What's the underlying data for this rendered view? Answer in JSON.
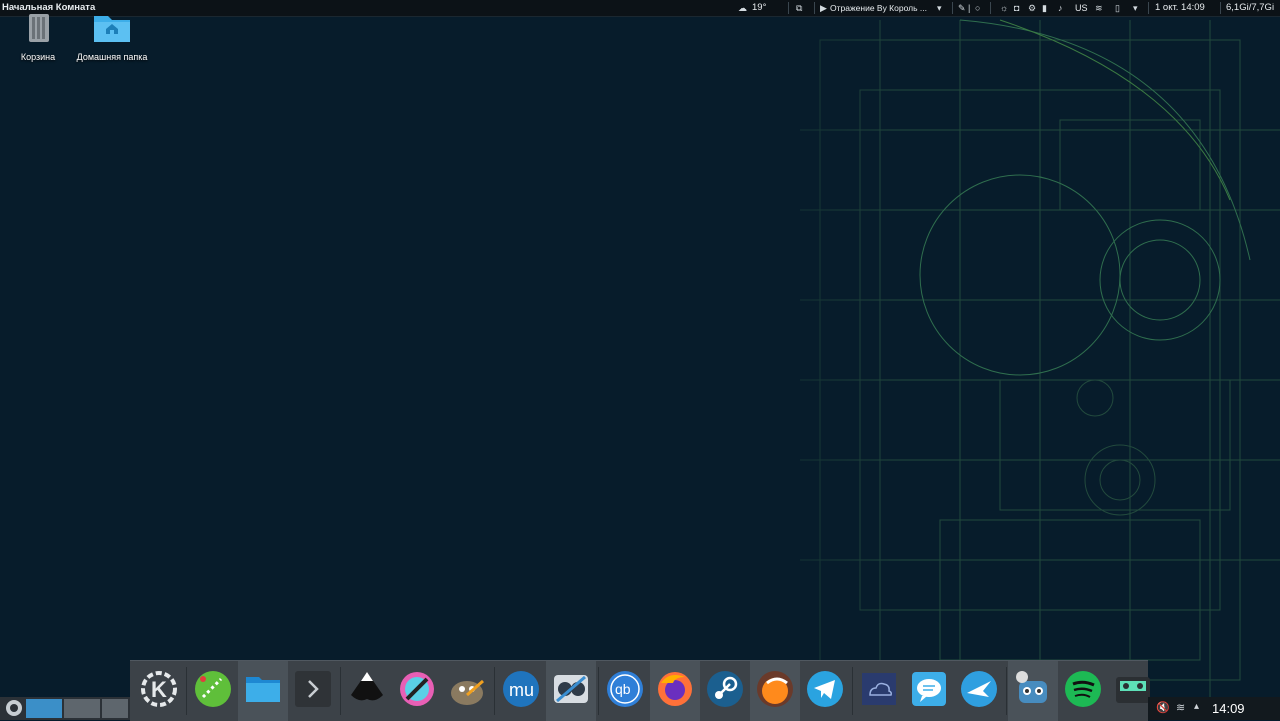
{
  "top_panel": {
    "window_title": "Начальная Комната",
    "weather": "19°",
    "media_text": "Отражение By Король ...",
    "keyboard_layout": "US",
    "datetime": "1 окт. 14:09",
    "memory": "6,1Gi/7,7Gi"
  },
  "desktop": {
    "icons": [
      {
        "label": "Корзина",
        "icon": "trash-icon"
      },
      {
        "label": "Домашняя папка",
        "icon": "home-folder-icon"
      }
    ]
  },
  "dock": {
    "apps": [
      {
        "name": "kde-menu",
        "icon": "kde-logo-icon"
      },
      {
        "name": "krita-like",
        "icon": "green-app-icon"
      },
      {
        "name": "file-manager",
        "icon": "folder-icon"
      },
      {
        "name": "terminal",
        "icon": "terminal-icon"
      },
      {
        "name": "inkscape",
        "icon": "inkscape-icon"
      },
      {
        "name": "krita",
        "icon": "krita-icon"
      },
      {
        "name": "gimp",
        "icon": "gimp-icon"
      },
      {
        "name": "musescore",
        "icon": "musescore-icon"
      },
      {
        "name": "video-editor",
        "icon": "video-editor-icon"
      },
      {
        "name": "qbittorrent",
        "icon": "qbittorrent-icon"
      },
      {
        "name": "firefox",
        "icon": "firefox-icon"
      },
      {
        "name": "steam",
        "icon": "steam-icon"
      },
      {
        "name": "browser",
        "icon": "orange-browser-icon"
      },
      {
        "name": "telegram",
        "icon": "telegram-icon"
      },
      {
        "name": "cloud",
        "icon": "cloud-icon"
      },
      {
        "name": "messenger",
        "icon": "chat-icon"
      },
      {
        "name": "transmission",
        "icon": "bird-icon"
      },
      {
        "name": "godot",
        "icon": "godot-icon"
      },
      {
        "name": "spotify",
        "icon": "spotify-icon"
      },
      {
        "name": "tape-app",
        "icon": "cassette-icon"
      }
    ]
  },
  "tray": {
    "time": "14:09"
  },
  "colors": {
    "background": "#071c2b",
    "blueprint_lines": "#2f6a4a",
    "panel": "#0c1217",
    "dock": "#3c4248"
  }
}
